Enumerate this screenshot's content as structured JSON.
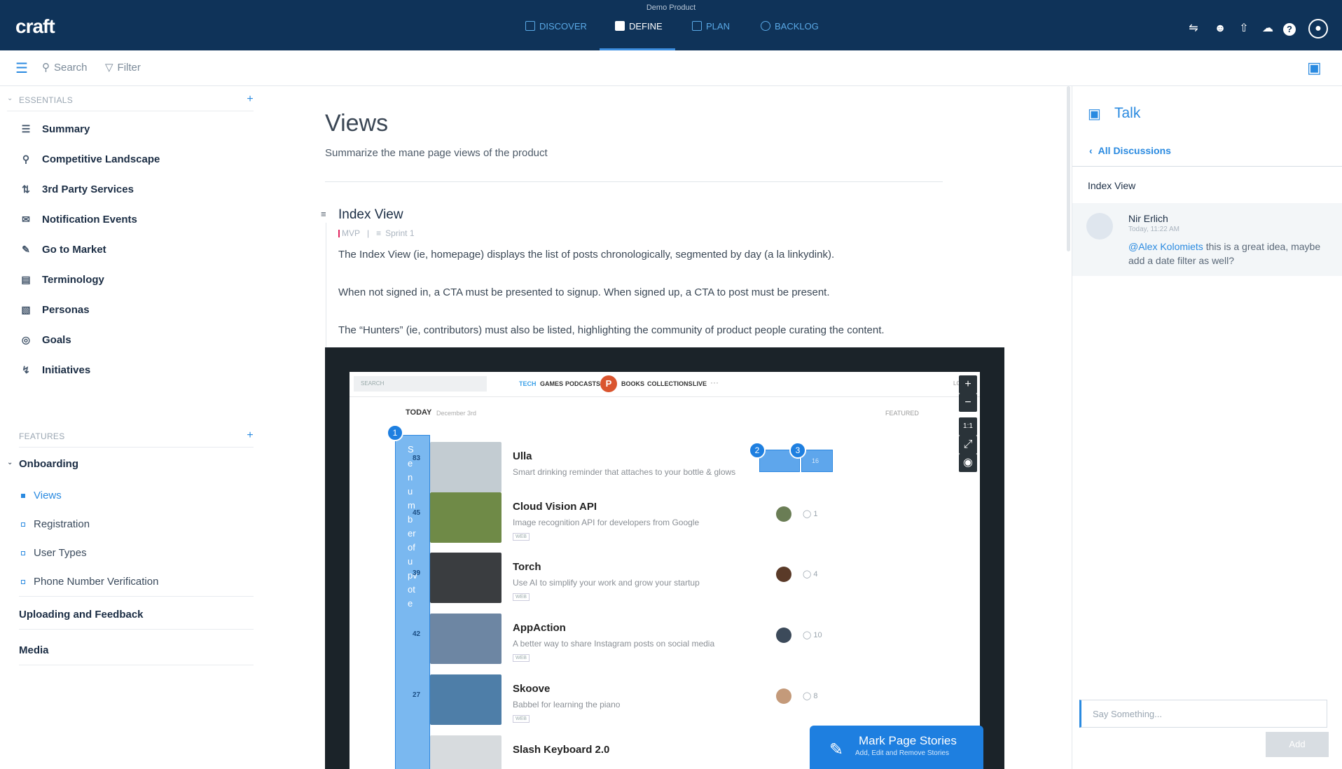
{
  "app": {
    "product_name": "Demo Product",
    "logo": "craft"
  },
  "nav": {
    "tabs": [
      {
        "label": "DISCOVER",
        "icon": "discover-icon"
      },
      {
        "label": "DEFINE",
        "icon": "define-icon",
        "active": true
      },
      {
        "label": "PLAN",
        "icon": "plan-icon"
      },
      {
        "label": "BACKLOG",
        "icon": "backlog-icon"
      }
    ],
    "right_icons": [
      "integrations-icon",
      "team-icon",
      "share-icon",
      "cloud-icon",
      "help-icon",
      "user-avatar-icon"
    ]
  },
  "toolbar": {
    "search_label": "Search",
    "filter_label": "Filter"
  },
  "sidebar": {
    "essentials_title": "ESSENTIALS",
    "essentials": [
      {
        "label": "Summary",
        "icon": "list-icon"
      },
      {
        "label": "Competitive Landscape",
        "icon": "ribbon-icon"
      },
      {
        "label": "3rd Party Services",
        "icon": "sync-icon"
      },
      {
        "label": "Notification Events",
        "icon": "mail-icon"
      },
      {
        "label": "Go to Market",
        "icon": "edit-icon"
      },
      {
        "label": "Terminology",
        "icon": "glossary-icon"
      },
      {
        "label": "Personas",
        "icon": "id-card-icon"
      },
      {
        "label": "Goals",
        "icon": "target-icon"
      },
      {
        "label": "Initiatives",
        "icon": "bolt-icon"
      }
    ],
    "features_title": "FEATURES",
    "group_onboarding": "Onboarding",
    "onboarding_items": [
      "Views",
      "Registration",
      "User Types",
      "Phone Number Verification"
    ],
    "group_uploading": "Uploading and Feedback",
    "group_media": "Media"
  },
  "main": {
    "title": "Views",
    "subtitle": "Summarize the mane page views of the product",
    "section_title": "Index View",
    "tag_mvp": "MVP",
    "tag_sprint": "Sprint 1",
    "paragraphs": [
      "The Index View (ie, homepage) displays the list of posts chronologically, segmented by day (a la linkydink).",
      "When not signed in, a CTA must be presented to signup.  When signed up, a CTA to post must be present.",
      "The “Hunters” (ie, contributors) must also be listed, highlighting the community of product people curating the content."
    ]
  },
  "mockup": {
    "search_placeholder": "SEARCH",
    "menu": [
      "TECH",
      "GAMES",
      "PODCASTS",
      "BOOKS",
      "COLLECTIONS",
      "LIVE"
    ],
    "login": "LOGI",
    "today": "TODAY",
    "date": "December 3rd",
    "featured": "FEATURED",
    "vote_bar_text": "Se number of upvote",
    "posts": [
      {
        "title": "Ulla",
        "desc": "Smart drinking reminder that attaches to your bottle & glows",
        "votes": "83",
        "comments": "16"
      },
      {
        "title": "Cloud Vision API",
        "desc": "Image recognition API for developers from Google",
        "votes": "45",
        "comments": "1"
      },
      {
        "title": "Torch",
        "desc": "Use AI to simplify your work and grow your startup",
        "votes": "39",
        "comments": "4"
      },
      {
        "title": "AppAction",
        "desc": "A better way to share Instagram posts on social media",
        "votes": "42",
        "comments": "10"
      },
      {
        "title": "Skoove",
        "desc": "Babbel for learning the piano",
        "votes": "27",
        "comments": "8"
      },
      {
        "title": "Slash Keyboard 2.0",
        "desc": "",
        "votes": "",
        "comments": ""
      }
    ],
    "web_badge": "WEB",
    "pins": [
      "1",
      "2",
      "3"
    ],
    "zoom_ratio": "1:1",
    "cta_title": "Mark Page Stories",
    "cta_sub": "Add, Edit and Remove Stories"
  },
  "talk": {
    "title": "Talk",
    "back_label": "All Discussions",
    "thread_title": "Index View",
    "comment": {
      "author": "Nir Erlich",
      "time": "Today, 11:22 AM",
      "mention": "@Alex Kolomiets",
      "text": " this is a great idea, maybe add a date filter as well?"
    },
    "input_placeholder": "Say Something...",
    "add_label": "Add"
  }
}
